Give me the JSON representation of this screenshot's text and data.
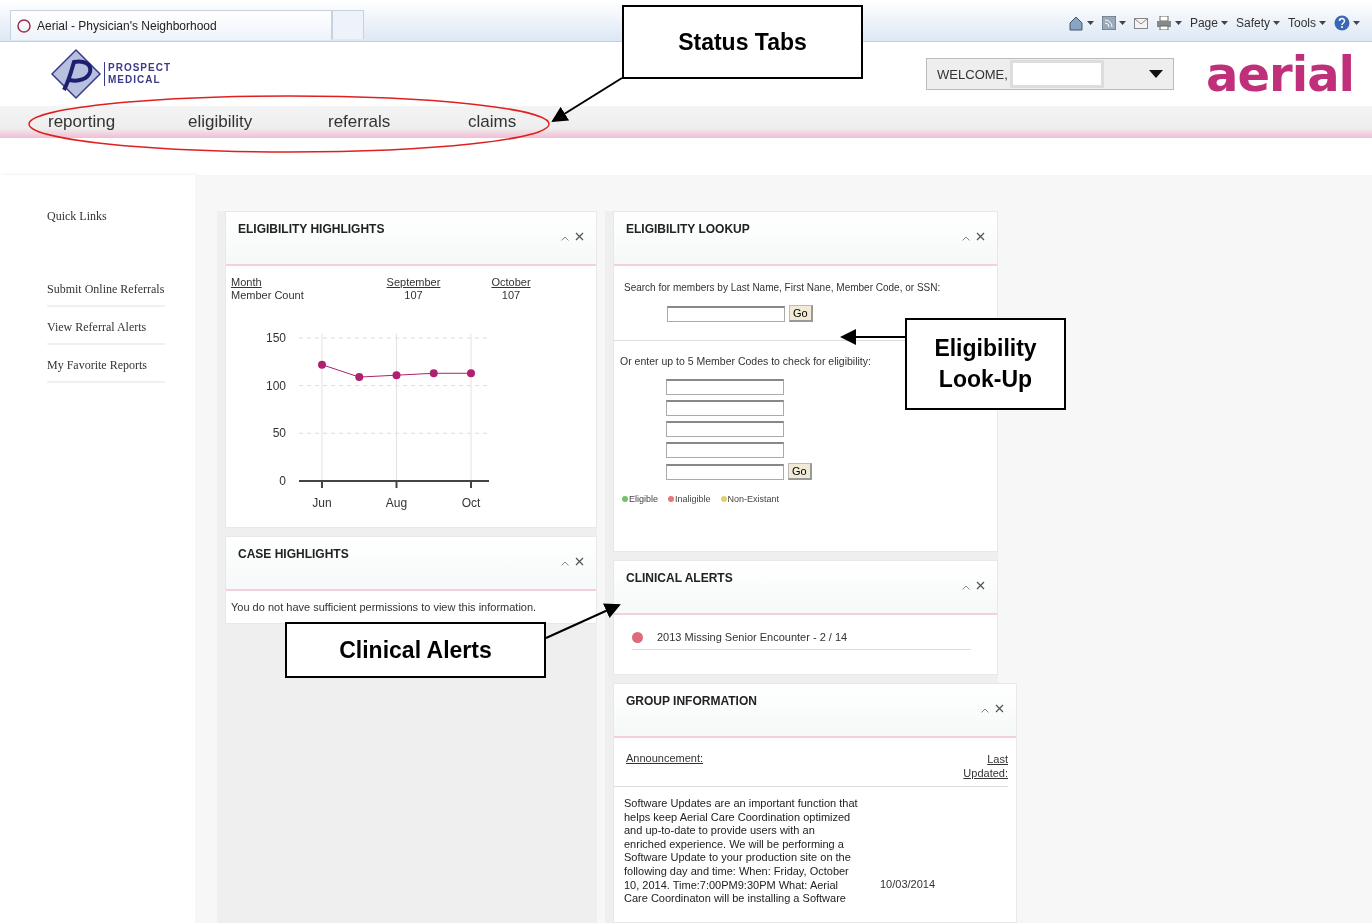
{
  "browser": {
    "tab_title": "Aerial - Physician's Neighborhood",
    "toolbar": [
      {
        "kind": "home"
      },
      {
        "kind": "feed"
      },
      {
        "kind": "mail"
      },
      {
        "kind": "print"
      },
      {
        "kind": "menu",
        "label": "Page"
      },
      {
        "kind": "menu",
        "label": "Safety"
      },
      {
        "kind": "menu",
        "label": "Tools"
      },
      {
        "kind": "help"
      }
    ]
  },
  "header": {
    "logo_lines": [
      "PROSPECT",
      "MEDICAL"
    ],
    "welcome": "WELCOME,",
    "brand": "aerial"
  },
  "nav": [
    {
      "label": "reporting"
    },
    {
      "label": "eligibility"
    },
    {
      "label": "referrals"
    },
    {
      "label": "claims"
    }
  ],
  "sidebar": {
    "title": "Quick Links",
    "items": [
      "Submit Online Referrals",
      "View Referral Alerts",
      "My Favorite Reports"
    ]
  },
  "eligibility_highlights": {
    "title": "ELIGIBILITY HIGHLIGHTS",
    "columns": [
      {
        "heading": "Month",
        "value": "Member Count"
      },
      {
        "heading": "September",
        "value": "107"
      },
      {
        "heading": "October",
        "value": "107"
      }
    ],
    "chart_data": {
      "type": "line",
      "categories": [
        "Jun",
        null,
        "Aug",
        null,
        "Oct"
      ],
      "grid": true,
      "series": [
        {
          "color": "#b0206e",
          "marker": true,
          "values": [
            122,
            109,
            111,
            113,
            113
          ]
        }
      ],
      "ylim": [
        0,
        150
      ],
      "yticks": [
        0,
        50,
        100,
        150
      ]
    }
  },
  "case_highlights": {
    "title": "CASE HIGHLIGHTS",
    "message": "You do not have sufficient permissions to view this information."
  },
  "eligibility_lookup": {
    "title": "ELIGIBILITY LOOKUP",
    "search_label": "Search for members by Last Name, First Nane, Member Code, or SSN:",
    "go": "Go",
    "codes_label": "Or enter up to 5 Member Codes to check for eligibility:",
    "go_codes": "Go",
    "legend": [
      {
        "label": "Eligible",
        "color": "#78c070"
      },
      {
        "label": "Inaligible",
        "color": "#e87878"
      },
      {
        "label": "Non-Existant",
        "color": "#e0d070"
      }
    ]
  },
  "clinical_alerts": {
    "title": "CLINICAL ALERTS",
    "items": [
      {
        "text": "2013 Missing Senior Encounter - 2 / 14",
        "color": "#e06a78"
      }
    ]
  },
  "group_information": {
    "title": "GROUP INFORMATION",
    "announcement_heading": "Announcement:",
    "updated_heading": "Last Updated:",
    "announcement": "Software Updates are an important function that helps keep Aerial Care Coordination optimized and up-to-date to provide users with an enriched experience. We will be performing a Software Update to your production site on the following day and time: When: Friday, October 10, 2014. Time:7:00PM9:30PM What: Aerial Care Coordinaton will be installing a Software",
    "updated": "10/03/2014"
  },
  "callouts": [
    {
      "text": "Status Tabs"
    },
    {
      "text": "Eligibility Look-Up"
    },
    {
      "text": "Clinical Alerts"
    }
  ]
}
